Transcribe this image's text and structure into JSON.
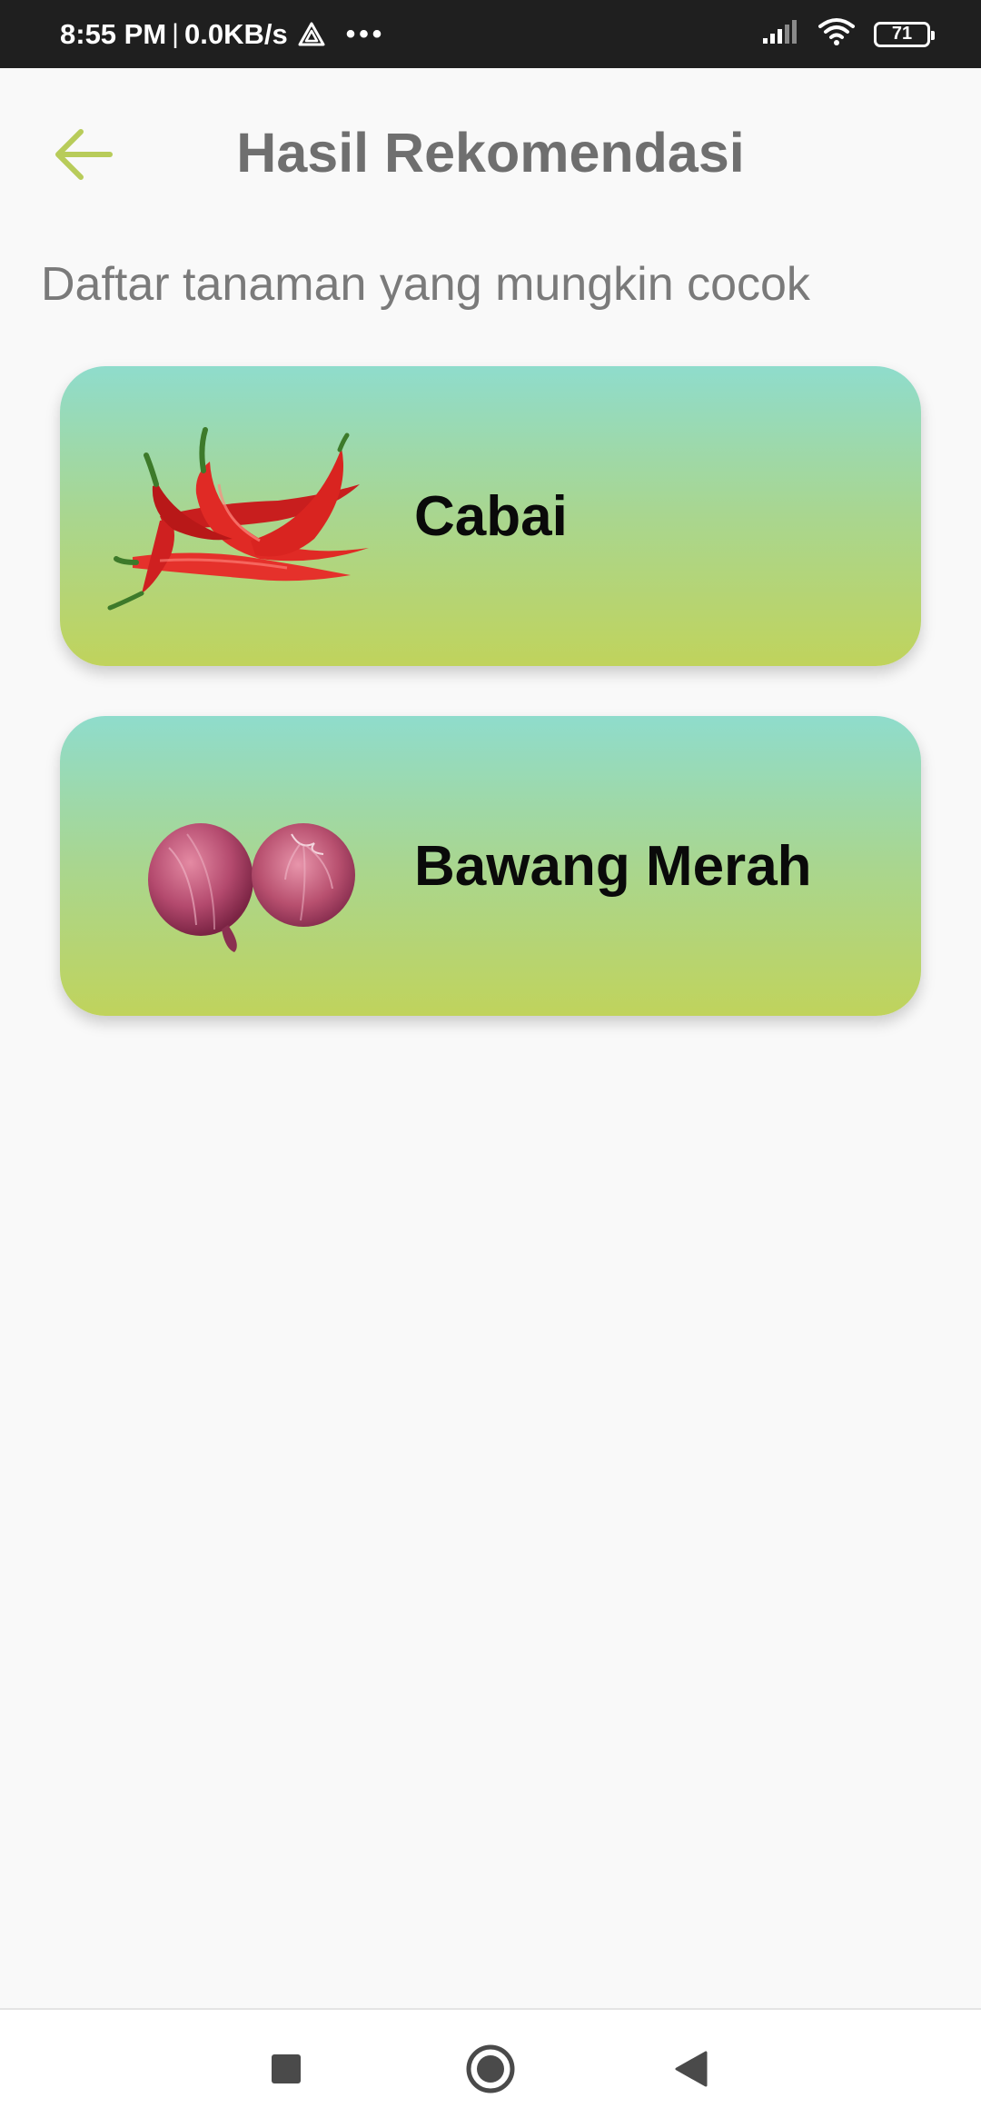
{
  "status_bar": {
    "time": "8:55 PM",
    "separator": "|",
    "speed": "0.0KB/s",
    "overflow": "•••",
    "battery": "71",
    "icons": [
      "drive-icon",
      "signal-icon",
      "wifi-icon",
      "battery-icon"
    ]
  },
  "header": {
    "title": "Hasil Rekomendasi",
    "back_icon": "arrow-left-icon"
  },
  "subtitle": "Daftar tanaman yang mungkin cocok",
  "recommendations": [
    {
      "name": "Cabai",
      "image": "chili-pepper-image"
    },
    {
      "name": "Bawang Merah",
      "image": "red-shallot-image"
    }
  ],
  "nav_bar": {
    "buttons": [
      "recents-square-icon",
      "home-circle-icon",
      "back-triangle-icon"
    ]
  },
  "colors": {
    "accent": "#b8cc5a",
    "card_gradient_top": "#8fdccc",
    "card_gradient_bottom": "#c0d35c",
    "title_text": "#6f6f6f"
  }
}
